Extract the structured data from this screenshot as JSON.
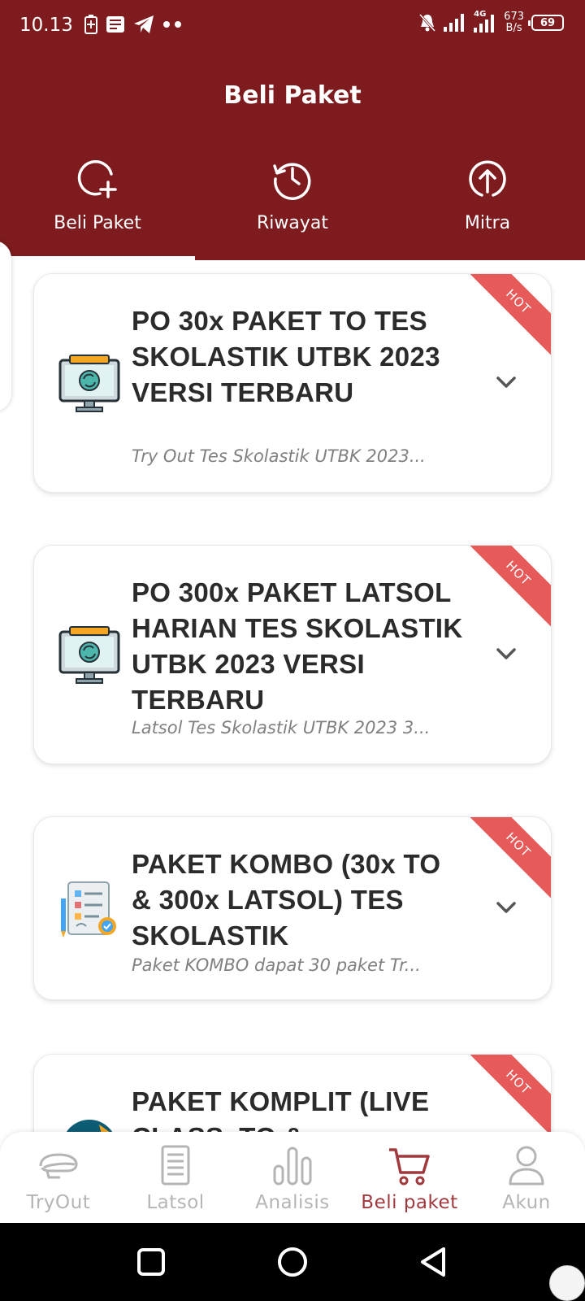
{
  "status_bar": {
    "time": "10.13",
    "net_speed_value": "673",
    "net_speed_unit": "B/s",
    "battery": "69",
    "network_type": "4G"
  },
  "header": {
    "title": "Beli Paket",
    "tabs": [
      {
        "label": "Beli Paket",
        "icon": "add-circle-icon",
        "active": true
      },
      {
        "label": "Riwayat",
        "icon": "history-icon",
        "active": false
      },
      {
        "label": "Mitra",
        "icon": "upload-circle-icon",
        "active": false
      }
    ]
  },
  "packages": [
    {
      "title": "PO 30x PAKET TO TES SKOLASTIK UTBK 2023 VERSI TERBARU",
      "description": "Try Out Tes Skolastik UTBK 2023...",
      "badge": "HOT",
      "icon": "monitor-sync-icon"
    },
    {
      "title": "PO 300x PAKET LATSOL HARIAN TES SKOLASTIK UTBK 2023 VERSI TERBARU",
      "description": "Latsol Tes Skolastik UTBK 2023 3...",
      "badge": "HOT",
      "icon": "monitor-sync-icon"
    },
    {
      "title": "PAKET KOMBO (30x TO & 300x LATSOL) TES SKOLASTIK",
      "description": "Paket KOMBO dapat 30 paket Tr...",
      "badge": "HOT",
      "icon": "checklist-clipboard-icon"
    },
    {
      "title": "PAKET KOMPLIT (LIVE CLASS, TO &",
      "description": "",
      "badge": "HOT",
      "icon": "live-class-icon"
    }
  ],
  "bottom_nav": [
    {
      "label": "TryOut",
      "icon": "helmet-icon",
      "active": false
    },
    {
      "label": "Latsol",
      "icon": "document-icon",
      "active": false
    },
    {
      "label": "Analisis",
      "icon": "bar-chart-icon",
      "active": false
    },
    {
      "label": "Beli paket",
      "icon": "cart-icon",
      "active": true
    },
    {
      "label": "Akun",
      "icon": "user-icon",
      "active": false
    }
  ],
  "colors": {
    "header_bg": "#7d1b1e",
    "badge": "#e65a5a",
    "active_nav": "#a03a3f",
    "inactive_nav": "#b5b5b5"
  }
}
